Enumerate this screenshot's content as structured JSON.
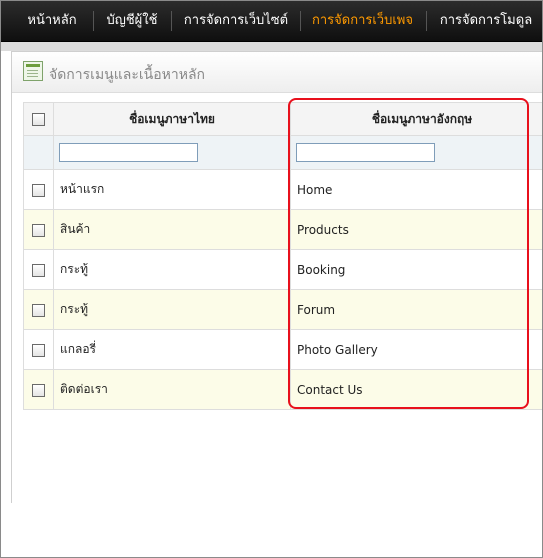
{
  "nav": {
    "items": [
      {
        "label": "หน้าหลัก",
        "active": false
      },
      {
        "label": "บัญชีผู้ใช้",
        "active": false
      },
      {
        "label": "การจัดการเว็บไซต์",
        "active": false
      },
      {
        "label": "การจัดการเว็บเพจ",
        "active": true
      },
      {
        "label": "การจัดการโมดูล",
        "active": false
      }
    ],
    "active_color": "#ff9a00"
  },
  "panel": {
    "title": "จัดการเมนูและเนื้อหาหลัก",
    "icon": "edit-page-icon"
  },
  "table": {
    "headers": {
      "thai": "ชื่อเมนูภาษาไทย",
      "english": "ชื่อเมนูภาษาอังกฤษ"
    },
    "filters": {
      "thai": "",
      "english": ""
    },
    "rows": [
      {
        "thai": "หน้าแรก",
        "english": "Home"
      },
      {
        "thai": "สินค้า",
        "english": "Products"
      },
      {
        "thai": "กระทู้",
        "english": "Booking"
      },
      {
        "thai": "กระทู้",
        "english": "Forum"
      },
      {
        "thai": "แกลอรี่",
        "english": "Photo Gallery"
      },
      {
        "thai": "ติดต่อเรา",
        "english": "Contact Us"
      }
    ]
  },
  "highlight_color": "#e8101c"
}
